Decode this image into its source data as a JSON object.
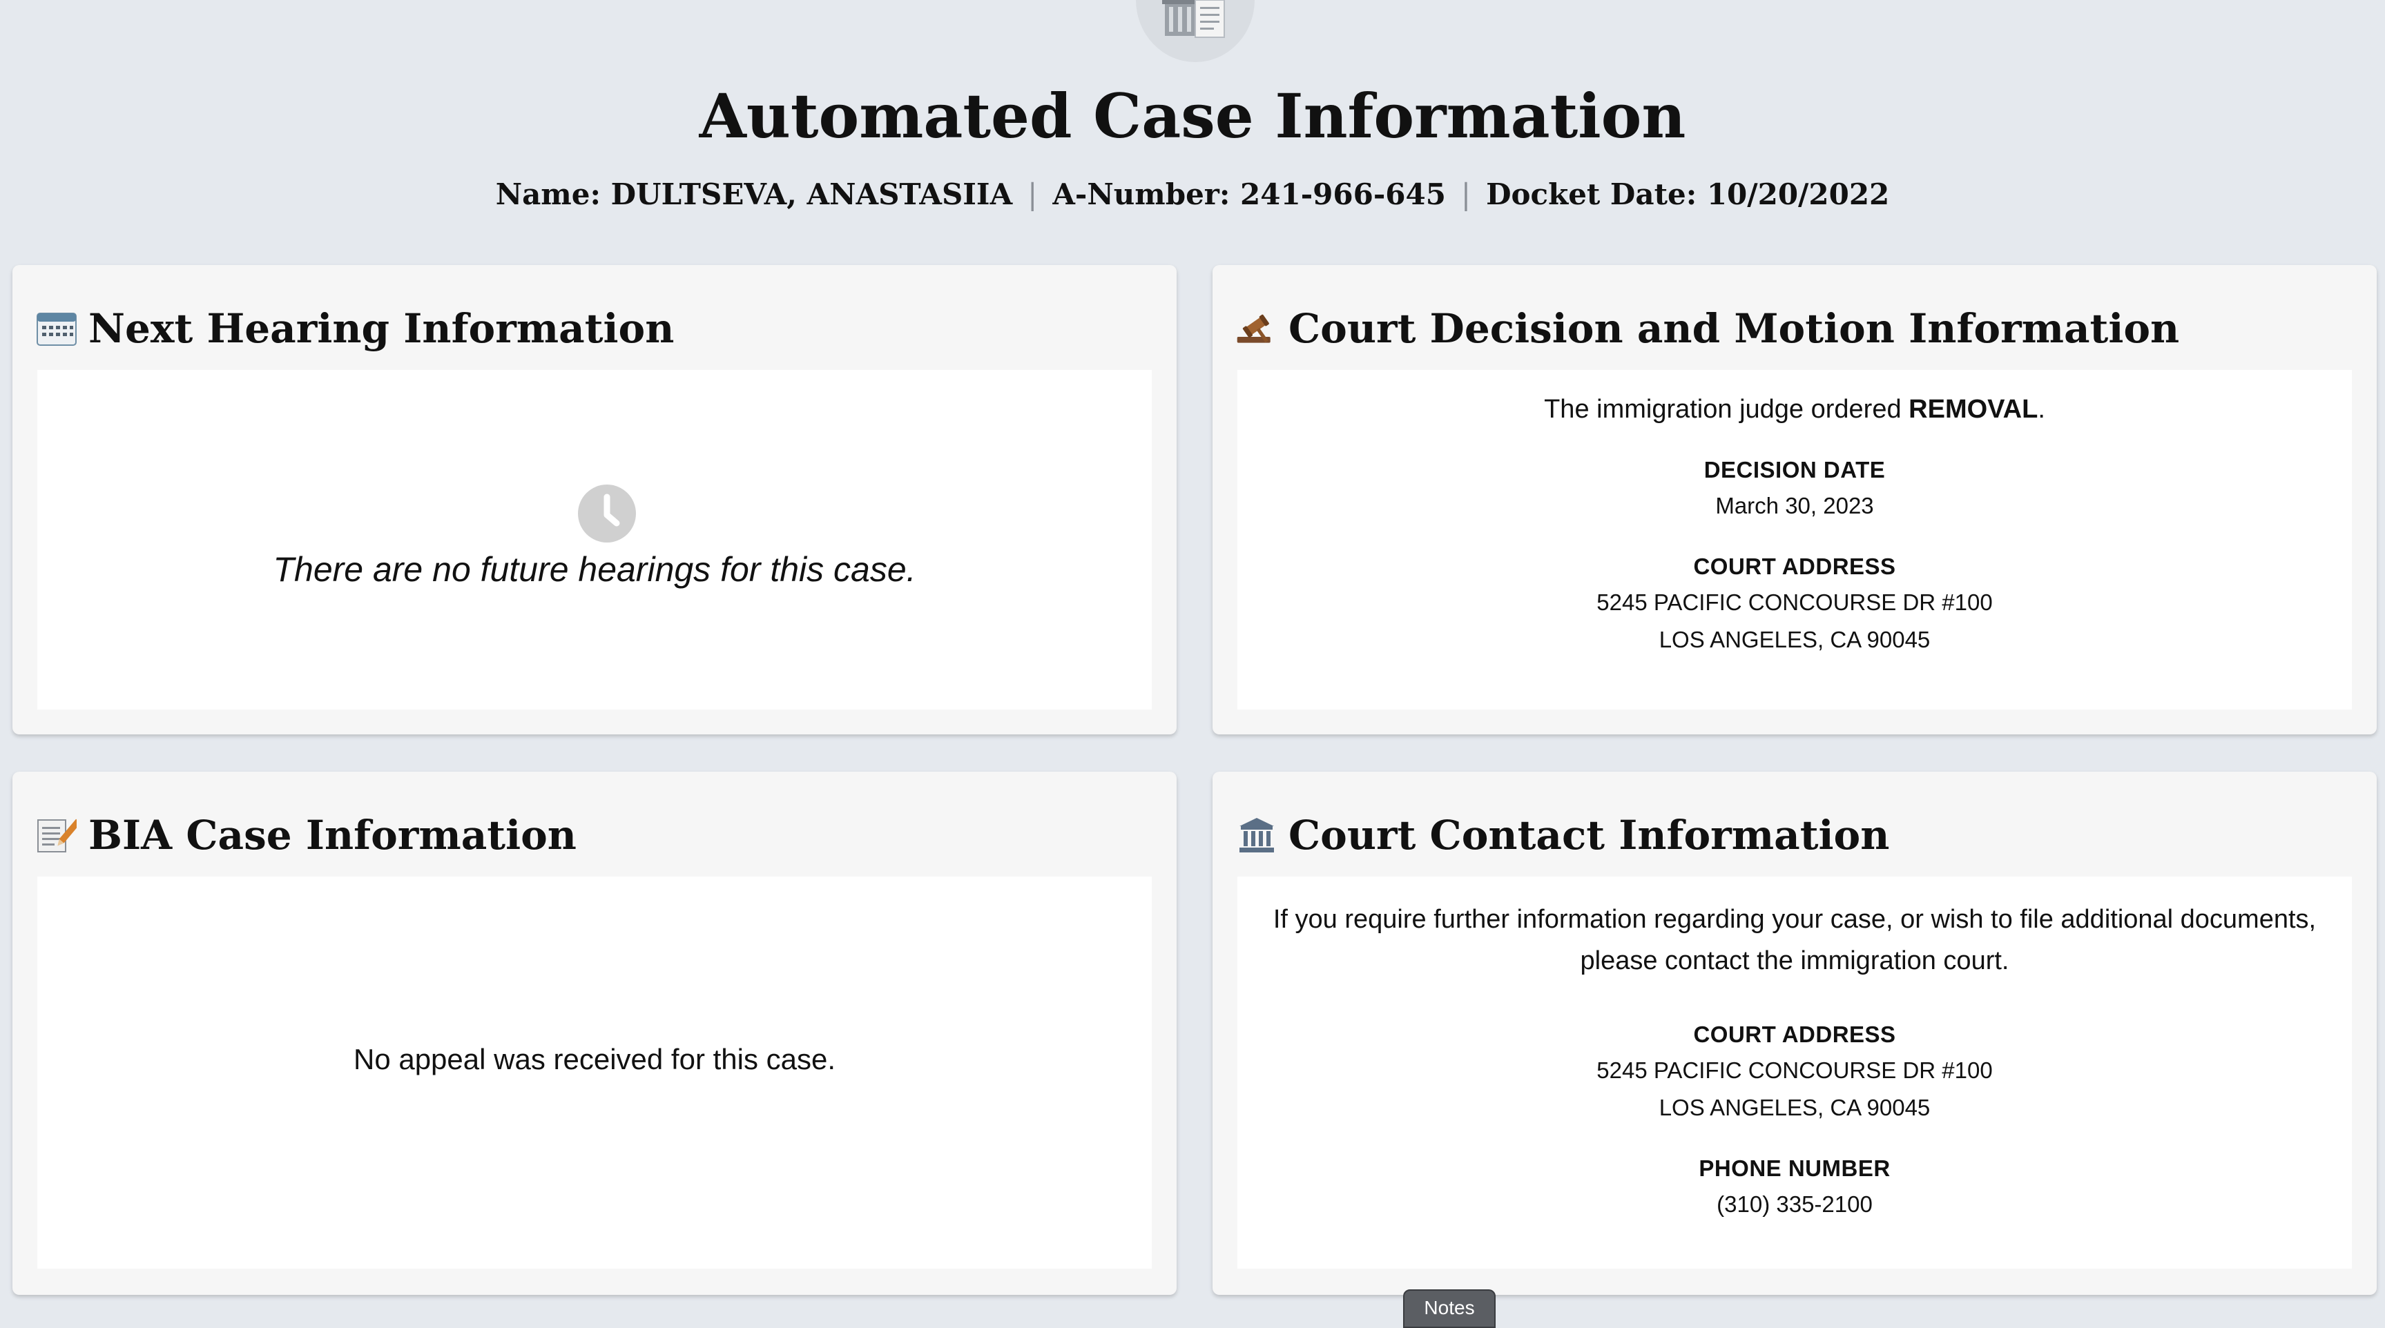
{
  "header": {
    "icon": "court-document-icon",
    "title": "Automated Case Information",
    "name": "Name: DULTSEVA, ANASTASIIA",
    "a_number": "A-Number: 241-966-645",
    "docket_date": "Docket Date: 10/20/2022"
  },
  "next_hearing": {
    "icon": "calendar-icon",
    "title": "Next Hearing Information",
    "status_icon": "clock-icon",
    "message": "There are no future hearings for this case."
  },
  "court_decision": {
    "icon": "gavel-icon",
    "title": "Court Decision and Motion Information",
    "statement_prefix": "The immigration judge ordered ",
    "statement_decision": "REMOVAL",
    "statement_suffix": ".",
    "decision_date_label": "DECISION DATE",
    "decision_date": "March 30, 2023",
    "court_address_label": "COURT ADDRESS",
    "address_line1": "5245 PACIFIC CONCOURSE DR #100",
    "address_line2": "LOS ANGELES, CA 90045"
  },
  "bia_case": {
    "icon": "memo-icon",
    "title": "BIA Case Information",
    "message": "No appeal was received for this case."
  },
  "court_contact": {
    "icon": "courthouse-icon",
    "title": "Court Contact Information",
    "intro_line1": "If you require further information regarding your case, or wish to file additional documents,",
    "intro_line2": "please contact the immigration court.",
    "court_address_label": "COURT ADDRESS",
    "address_line1": "5245 PACIFIC CONCOURSE DR #100",
    "address_line2": "LOS ANGELES, CA 90045",
    "phone_label": "PHONE NUMBER",
    "phone": "(310) 335-2100"
  },
  "notes_tab": {
    "label": "Notes"
  },
  "colors": {
    "page_background": "#e5e9ee",
    "card_background": "#f6f6f6",
    "panel_background": "#ffffff",
    "notes_tab": "#5b5e63"
  }
}
